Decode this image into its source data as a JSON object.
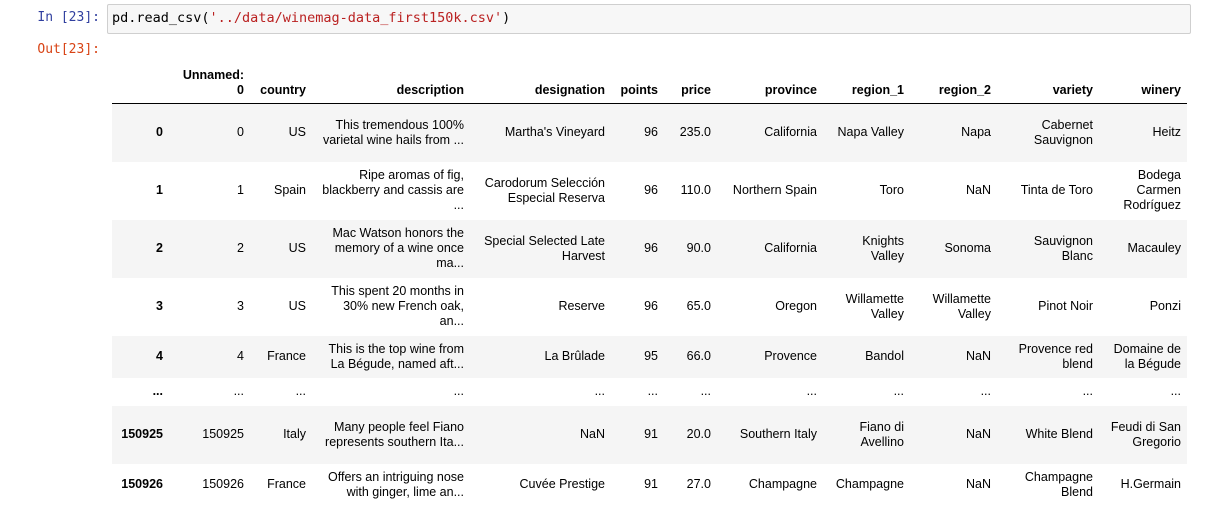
{
  "cell": {
    "in_prompt": "In [23]:",
    "out_prompt": "Out[23]:",
    "code_prefix": "pd.read_csv(",
    "code_string": "'../data/winemag-data_first150k.csv'",
    "code_suffix": ")"
  },
  "dataframe": {
    "columns": [
      "Unnamed: 0",
      "country",
      "description",
      "designation",
      "points",
      "price",
      "province",
      "region_1",
      "region_2",
      "variety",
      "winery"
    ],
    "rows": [
      {
        "index": "0",
        "values": [
          "0",
          "US",
          "This tremendous 100% varietal wine hails from ...",
          "Martha's Vineyard",
          "96",
          "235.0",
          "California",
          "Napa Valley",
          "Napa",
          "Cabernet Sauvignon",
          "Heitz"
        ]
      },
      {
        "index": "1",
        "values": [
          "1",
          "Spain",
          "Ripe aromas of fig, blackberry and cassis are ...",
          "Carodorum Selección Especial Reserva",
          "96",
          "110.0",
          "Northern Spain",
          "Toro",
          "NaN",
          "Tinta de Toro",
          "Bodega Carmen Rodríguez"
        ]
      },
      {
        "index": "2",
        "values": [
          "2",
          "US",
          "Mac Watson honors the memory of a wine once ma...",
          "Special Selected Late Harvest",
          "96",
          "90.0",
          "California",
          "Knights Valley",
          "Sonoma",
          "Sauvignon Blanc",
          "Macauley"
        ]
      },
      {
        "index": "3",
        "values": [
          "3",
          "US",
          "This spent 20 months in 30% new French oak, an...",
          "Reserve",
          "96",
          "65.0",
          "Oregon",
          "Willamette Valley",
          "Willamette Valley",
          "Pinot Noir",
          "Ponzi"
        ]
      },
      {
        "index": "4",
        "values": [
          "4",
          "France",
          "This is the top wine from La Bégude, named aft...",
          "La Brûlade",
          "95",
          "66.0",
          "Provence",
          "Bandol",
          "NaN",
          "Provence red blend",
          "Domaine de la Bégude"
        ]
      },
      {
        "index": "...",
        "values": [
          "...",
          "...",
          "...",
          "...",
          "...",
          "...",
          "...",
          "...",
          "...",
          "...",
          "..."
        ]
      },
      {
        "index": "150925",
        "values": [
          "150925",
          "Italy",
          "Many people feel Fiano represents southern Ita...",
          "NaN",
          "91",
          "20.0",
          "Southern Italy",
          "Fiano di Avellino",
          "NaN",
          "White Blend",
          "Feudi di San Gregorio"
        ]
      },
      {
        "index": "150926",
        "values": [
          "150926",
          "France",
          "Offers an intriguing nose with ginger, lime an...",
          "Cuvée Prestige",
          "91",
          "27.0",
          "Champagne",
          "Champagne",
          "NaN",
          "Champagne Blend",
          "H.Germain"
        ]
      }
    ]
  }
}
